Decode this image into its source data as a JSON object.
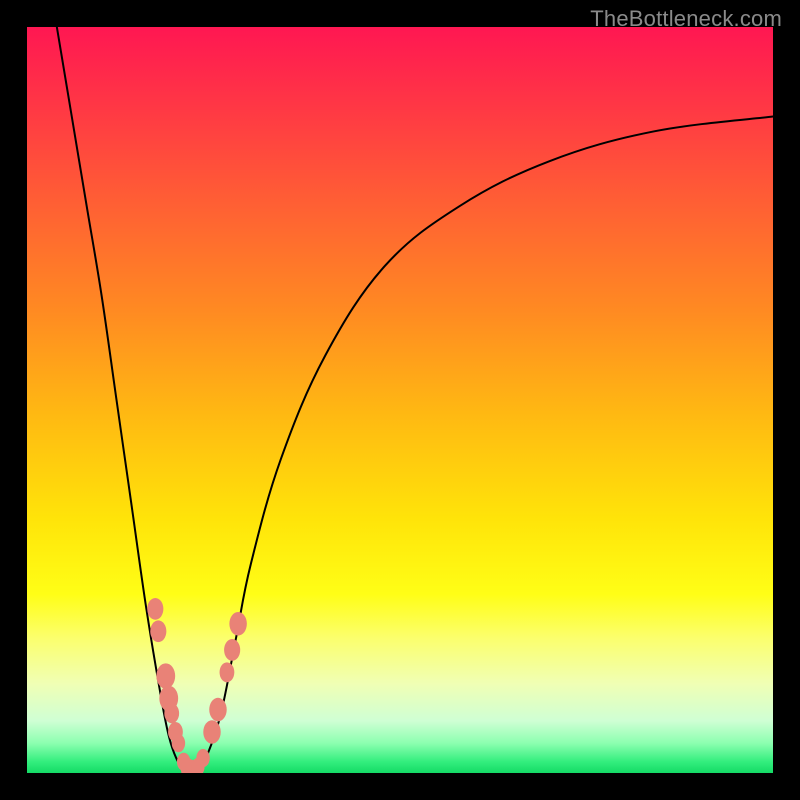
{
  "watermark": "TheBottleneck.com",
  "colors": {
    "curve_stroke": "#000000",
    "bead_fill": "#e98277",
    "background": "#000000"
  },
  "chart_data": {
    "type": "line",
    "title": "",
    "xlabel": "",
    "ylabel": "",
    "xlim": [
      0,
      100
    ],
    "ylim": [
      0,
      100
    ],
    "series": [
      {
        "name": "left-branch",
        "x": [
          4,
          6,
          8,
          10,
          12,
          14,
          16,
          18,
          19,
          20,
          21,
          22
        ],
        "y": [
          100,
          88,
          76,
          64,
          50,
          36,
          22,
          10,
          5,
          2,
          0.5,
          0
        ]
      },
      {
        "name": "right-branch",
        "x": [
          22,
          23,
          24,
          26,
          28,
          30,
          34,
          40,
          48,
          58,
          70,
          84,
          100
        ],
        "y": [
          0,
          0.5,
          2,
          8,
          18,
          28,
          42,
          56,
          68,
          76,
          82,
          86,
          88
        ]
      }
    ],
    "beads": [
      {
        "x": 17.2,
        "y": 22,
        "r": 1.2
      },
      {
        "x": 17.6,
        "y": 19,
        "r": 1.2
      },
      {
        "x": 18.6,
        "y": 13,
        "r": 1.4
      },
      {
        "x": 19.0,
        "y": 10,
        "r": 1.4
      },
      {
        "x": 19.4,
        "y": 8,
        "r": 1.1
      },
      {
        "x": 19.9,
        "y": 5.5,
        "r": 1.1
      },
      {
        "x": 20.3,
        "y": 4,
        "r": 1.0
      },
      {
        "x": 21.0,
        "y": 1.5,
        "r": 1.0
      },
      {
        "x": 21.6,
        "y": 0.6,
        "r": 1.1
      },
      {
        "x": 22.2,
        "y": 0.4,
        "r": 1.1
      },
      {
        "x": 22.9,
        "y": 0.8,
        "r": 1.0
      },
      {
        "x": 23.6,
        "y": 2.0,
        "r": 1.0
      },
      {
        "x": 24.8,
        "y": 5.5,
        "r": 1.3
      },
      {
        "x": 25.6,
        "y": 8.5,
        "r": 1.3
      },
      {
        "x": 26.8,
        "y": 13.5,
        "r": 1.1
      },
      {
        "x": 27.5,
        "y": 16.5,
        "r": 1.2
      },
      {
        "x": 28.3,
        "y": 20.0,
        "r": 1.3
      }
    ]
  }
}
